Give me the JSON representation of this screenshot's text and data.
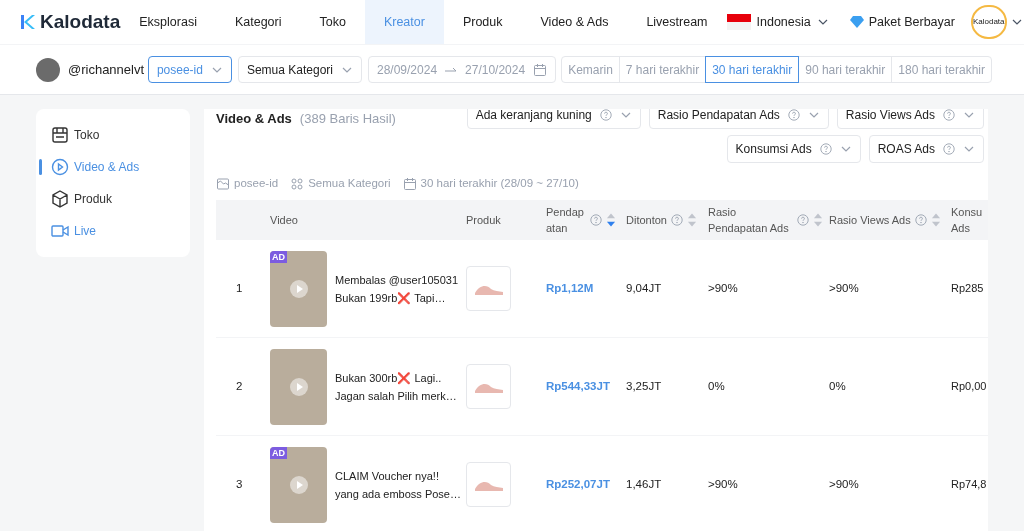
{
  "brand": "Kalodata",
  "nav": [
    {
      "label": "Eksplorasi",
      "selected": false
    },
    {
      "label": "Kategori",
      "selected": false
    },
    {
      "label": "Toko",
      "selected": false
    },
    {
      "label": "Kreator",
      "selected": true
    },
    {
      "label": "Produk",
      "selected": false
    },
    {
      "label": "Video & Ads",
      "selected": false
    },
    {
      "label": "Livestream",
      "selected": false
    }
  ],
  "country": "Indonesia",
  "plan": "Paket Berbayar",
  "avatar_text": "Kalodata",
  "creator": "@richannelvt",
  "filters": {
    "shop": "posee-id",
    "category": "Semua Kategori",
    "date_from": "28/09/2024",
    "date_to": "27/10/2024"
  },
  "periods": [
    {
      "label": "Kemarin",
      "selected": false
    },
    {
      "label": "7 hari terakhir",
      "selected": false
    },
    {
      "label": "30 hari terakhir",
      "selected": true
    },
    {
      "label": "90 hari terakhir",
      "selected": false
    },
    {
      "label": "180 hari terakhir",
      "selected": false
    }
  ],
  "sidebar": [
    {
      "label": "Toko",
      "selected": false,
      "kind": "page"
    },
    {
      "label": "Video & Ads",
      "selected": true,
      "kind": "page"
    },
    {
      "label": "Produk",
      "selected": false,
      "kind": "page"
    },
    {
      "label": "Live",
      "selected": false,
      "kind": "link"
    }
  ],
  "section": {
    "title": "Video & Ads",
    "count": "(389 Baris Hasil)"
  },
  "dropdowns": [
    "Ada keranjang kuning",
    "Rasio Pendapatan Ads",
    "Rasio Views Ads",
    "Konsumsi Ads",
    "ROAS Ads"
  ],
  "summary": [
    "posee-id",
    "Semua Kategori",
    "30 hari terakhir (28/09 ~ 27/10)"
  ],
  "table": {
    "columns": [
      {
        "label": "Video",
        "help": false,
        "sortable": false
      },
      {
        "label": "Produk",
        "help": false,
        "sortable": false
      },
      {
        "label": "Pendapatan",
        "help": true,
        "sortable": true,
        "sorted": true
      },
      {
        "label": "Ditonton",
        "help": true,
        "sortable": true,
        "sorted": false
      },
      {
        "label": "Rasio Pendapatan Ads",
        "help": true,
        "sortable": true,
        "sorted": false
      },
      {
        "label": "Rasio Views Ads",
        "help": true,
        "sortable": true,
        "sorted": false
      },
      {
        "label": "Konsu Ads",
        "help": false,
        "sortable": false
      }
    ],
    "rows": [
      {
        "rank": "1",
        "badge": "AD",
        "title": "Membalas @user105031 Bukan 199rb❌ Tapi…",
        "revenue": "Rp1,12M",
        "views": "9,04JT",
        "rev_ratio": ">90%",
        "views_ratio": ">90%",
        "spend": "Rp285"
      },
      {
        "rank": "2",
        "title": "Bukan 300rb❌ Lagi.. Jagan salah Pilih merk…",
        "revenue": "Rp544,33JT",
        "views": "3,25JT",
        "rev_ratio": "0%",
        "views_ratio": "0%",
        "spend": "Rp0,00"
      },
      {
        "rank": "3",
        "badge": "AD",
        "title": "CLAIM Voucher nya!! yang ada emboss Pose…",
        "revenue": "Rp252,07JT",
        "views": "1,46JT",
        "rev_ratio": ">90%",
        "views_ratio": ">90%",
        "spend": "Rp74,8"
      }
    ]
  }
}
